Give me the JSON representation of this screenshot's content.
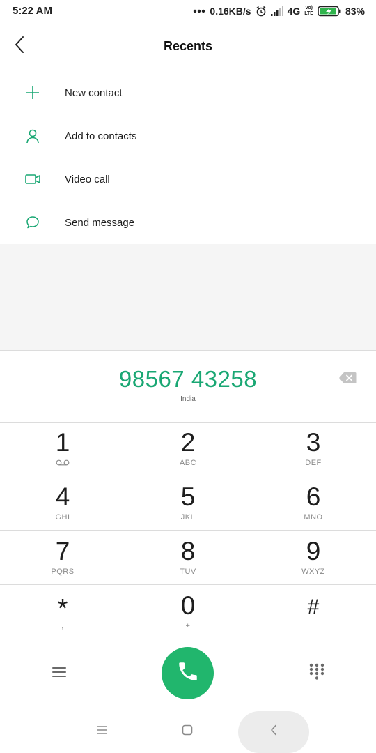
{
  "status_bar": {
    "time": "5:22 AM",
    "net_speed": "0.16KB/s",
    "network": "4G",
    "volte_line1": "Vo)",
    "volte_line2": "LTE",
    "battery": "83%"
  },
  "header": {
    "title": "Recents",
    "back_icon": "chevron-left-icon"
  },
  "actions": [
    {
      "label": "New contact",
      "icon": "plus-icon"
    },
    {
      "label": "Add to contacts",
      "icon": "person-icon"
    },
    {
      "label": "Video call",
      "icon": "video-camera-icon"
    },
    {
      "label": "Send message",
      "icon": "message-bubble-icon"
    }
  ],
  "dialer": {
    "number": "98567 43258",
    "region": "India"
  },
  "keypad": [
    [
      {
        "digit": "1",
        "letters": ""
      },
      {
        "digit": "2",
        "letters": "ABC"
      },
      {
        "digit": "3",
        "letters": "DEF"
      }
    ],
    [
      {
        "digit": "4",
        "letters": "GHI"
      },
      {
        "digit": "5",
        "letters": "JKL"
      },
      {
        "digit": "6",
        "letters": "MNO"
      }
    ],
    [
      {
        "digit": "7",
        "letters": "PQRS"
      },
      {
        "digit": "8",
        "letters": "TUV"
      },
      {
        "digit": "9",
        "letters": "WXYZ"
      }
    ],
    [
      {
        "digit": "*",
        "letters": ","
      },
      {
        "digit": "0",
        "letters": "+"
      },
      {
        "digit": "#",
        "letters": ""
      }
    ]
  ],
  "colors": {
    "accent": "#19a773",
    "call_button": "#21b66d",
    "gray_area": "#f5f5f5"
  }
}
